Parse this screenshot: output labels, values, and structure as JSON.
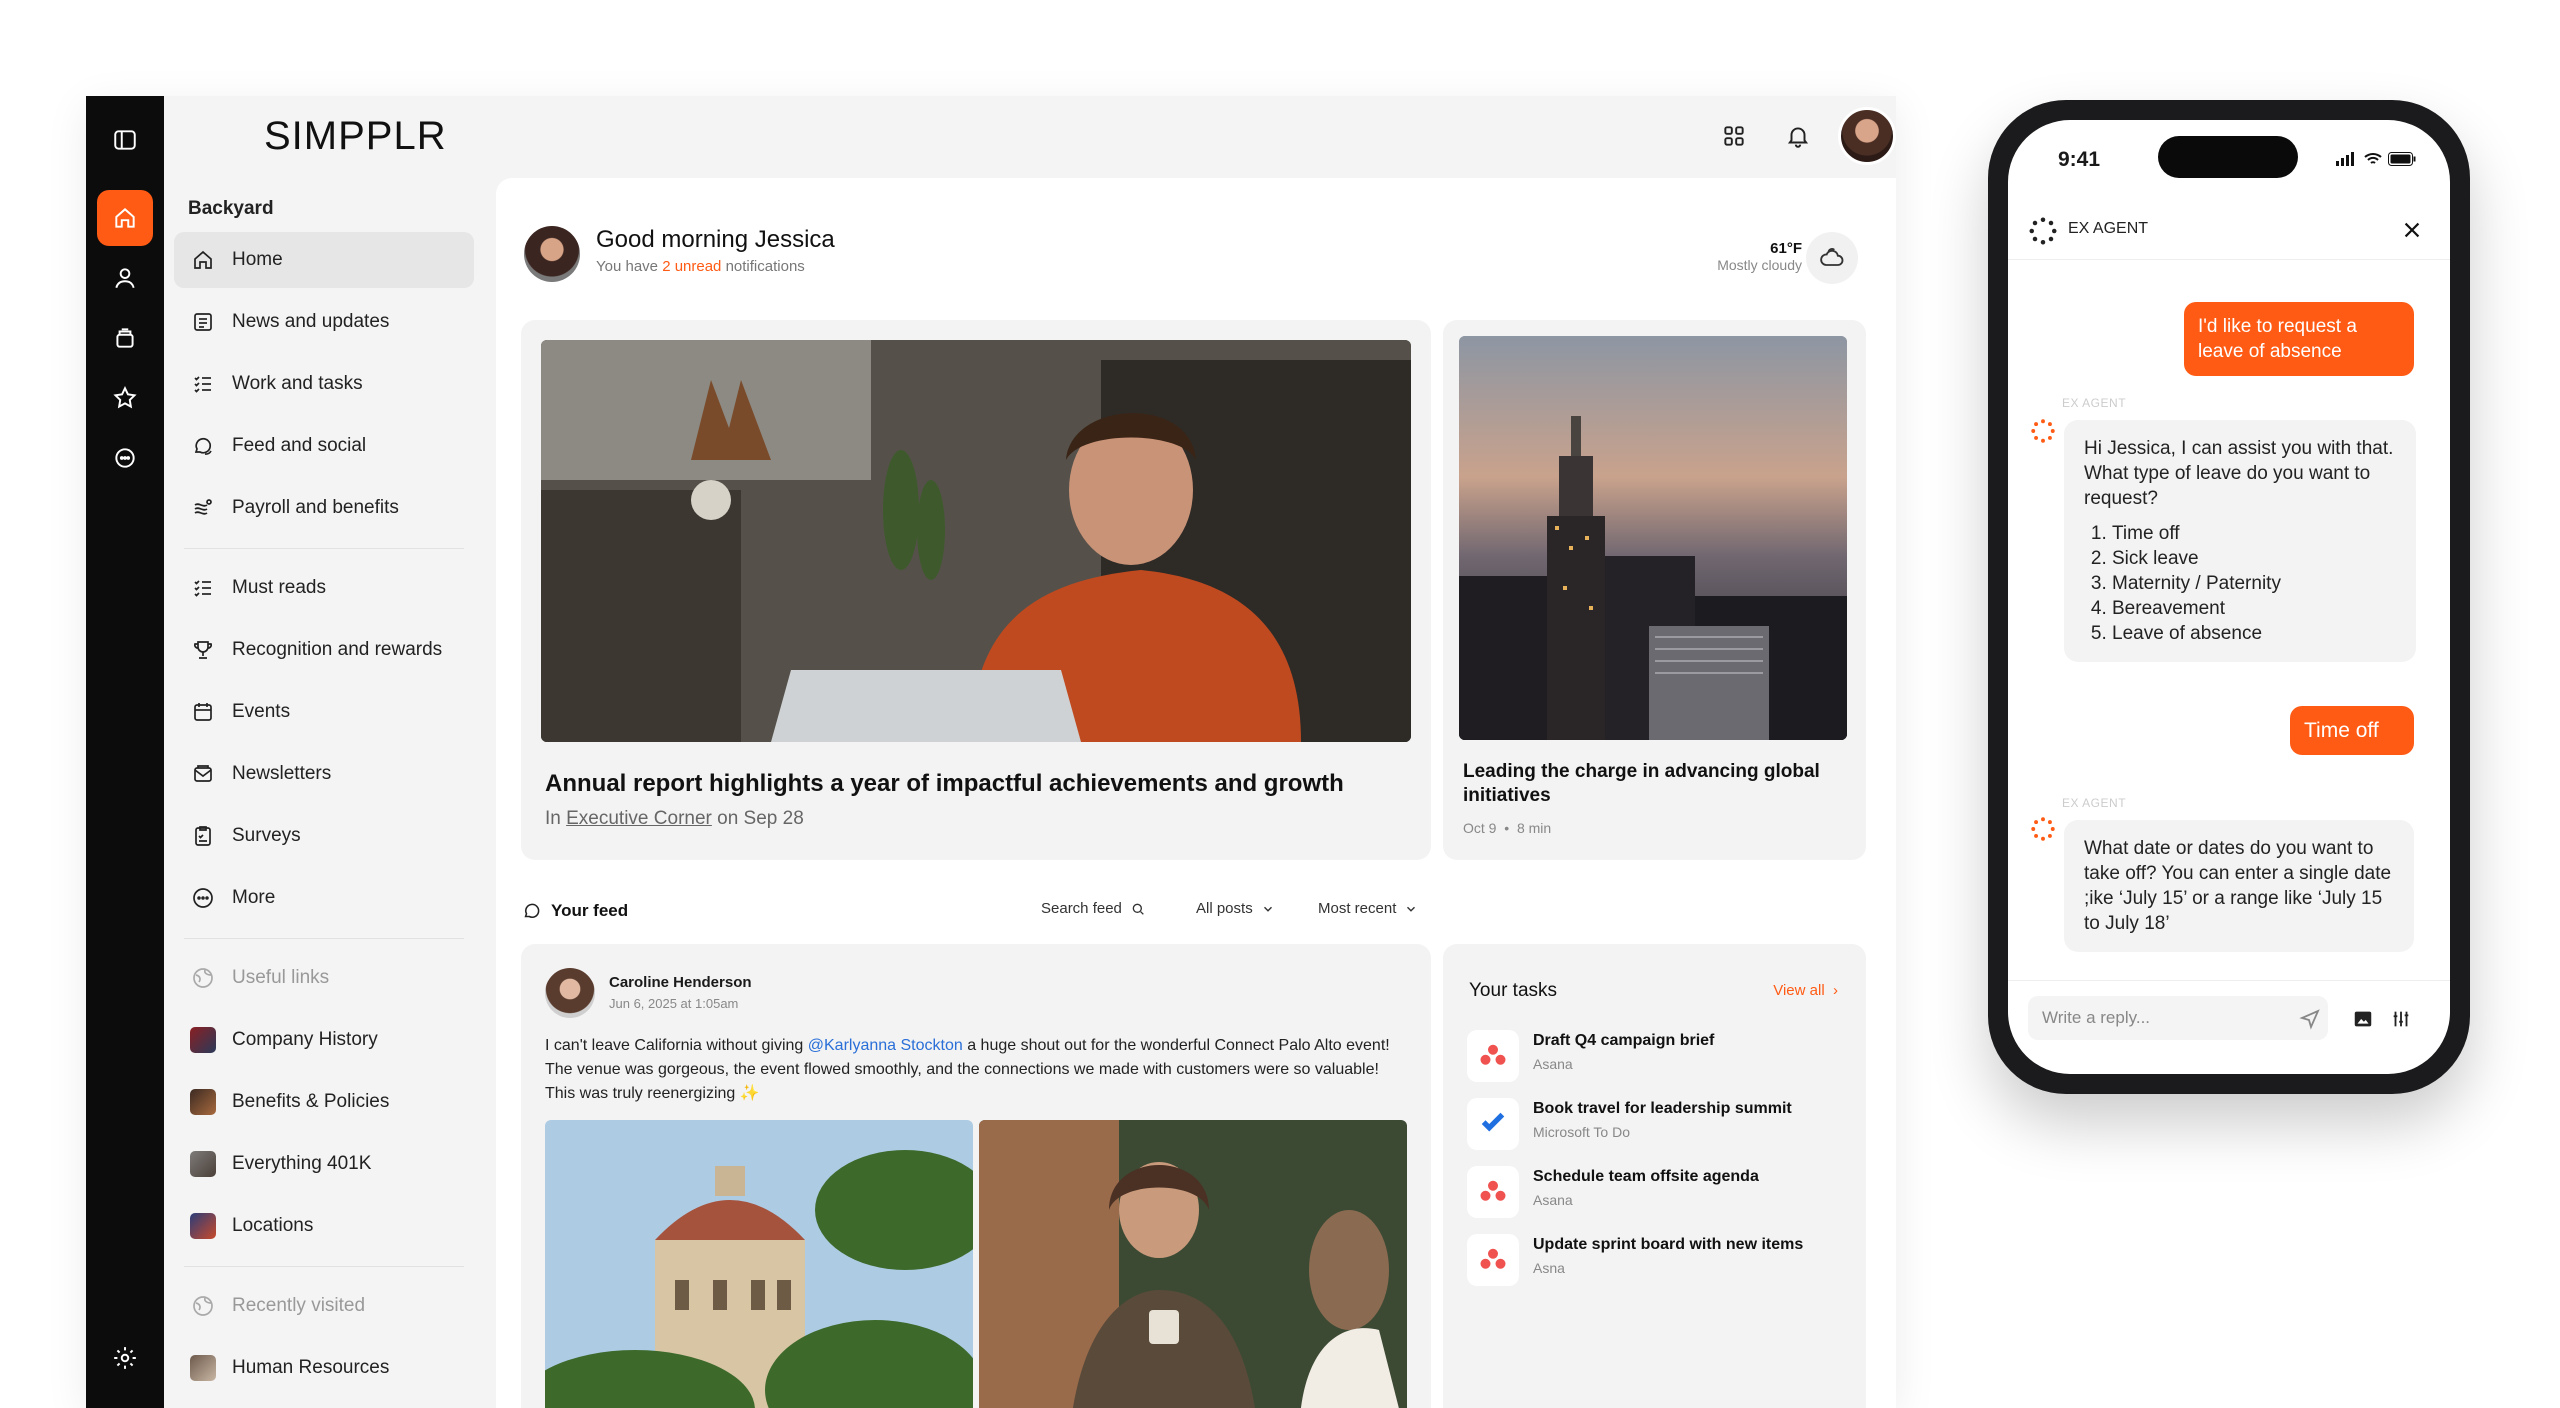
{
  "brand": {
    "logo": "SIMPPLR"
  },
  "sidebar": {
    "section": "Backyard",
    "items": [
      {
        "label": "Home",
        "icon": "home-icon"
      },
      {
        "label": "News and updates",
        "icon": "newspaper-icon"
      },
      {
        "label": "Work and tasks",
        "icon": "checklist-icon"
      },
      {
        "label": "Feed and social",
        "icon": "chat-icon"
      },
      {
        "label": "Payroll and benefits",
        "icon": "money-icon"
      },
      {
        "label": "Must reads",
        "icon": "checklist-icon"
      },
      {
        "label": "Recognition and rewards",
        "icon": "trophy-icon"
      },
      {
        "label": "Events",
        "icon": "calendar-icon"
      },
      {
        "label": "Newsletters",
        "icon": "mail-icon"
      },
      {
        "label": "Surveys",
        "icon": "survey-icon"
      },
      {
        "label": "More",
        "icon": "more-icon"
      }
    ],
    "useful_links_label": "Useful links",
    "useful_links": [
      "Company History",
      "Benefits & Policies",
      "Everything 401K",
      "Locations"
    ],
    "recently_visited_label": "Recently visited",
    "recent": [
      "Human Resources"
    ]
  },
  "greeting": {
    "title": "Good morning Jessica",
    "sub_prefix": "You have ",
    "sub_highlight": "2 unread",
    "sub_suffix": " notifications"
  },
  "weather": {
    "temp": "61°F",
    "desc": "Mostly cloudy"
  },
  "hero": {
    "title": "Annual report highlights a year of impactful achievements and growth",
    "meta_prefix": "In ",
    "meta_link": "Executive Corner",
    "meta_suffix": " on Sep 28"
  },
  "side_story": {
    "title": "Leading the charge in advancing global initiatives",
    "date": "Oct 9",
    "read_time": "8 min"
  },
  "feed": {
    "title": "Your feed",
    "search": "Search feed",
    "filter": "All posts",
    "sort": "Most recent"
  },
  "post": {
    "author": "Caroline Henderson",
    "date": "Jun 6, 2025 at 1:05am",
    "text_1": "I can't leave California without giving ",
    "mention": "@Karlyanna Stockton",
    "text_2": " a huge shout out for the wonderful Connect Palo Alto event! The venue was gorgeous, the event flowed smoothly, and the connections we made with customers were so valuable! This was truly reenergizing ✨"
  },
  "tasks": {
    "title": "Your tasks",
    "view_all": "View all",
    "items": [
      {
        "title": "Draft Q4 campaign brief",
        "source": "Asana"
      },
      {
        "title": "Book travel for leadership summit",
        "source": "Microsoft To Do"
      },
      {
        "title": "Schedule team offsite agenda",
        "source": "Asana"
      },
      {
        "title": "Update sprint board with new items",
        "source": "Asna"
      }
    ]
  },
  "phone": {
    "time": "9:41",
    "agent": "EX AGENT",
    "agent_label": "EX AGENT",
    "msg_user_1": "I'd like to request a leave of absence",
    "msg_agent_1": "Hi Jessica, I can assist you with that. What type of leave do you want to request?",
    "options": [
      "Time off",
      "Sick leave",
      "Maternity / Paternity",
      "Bereavement",
      "Leave of absence"
    ],
    "msg_user_2": "Time off",
    "msg_agent_2": "What date or dates do you want to take off? You can enter a single date ;ike ‘July 15’ or a range like ‘July 15 to July 18’",
    "reply_placeholder": "Write a reply..."
  },
  "colors": {
    "accent": "#ff5b14",
    "rail": "#0c0c0c",
    "link": "#2a6fd8"
  }
}
